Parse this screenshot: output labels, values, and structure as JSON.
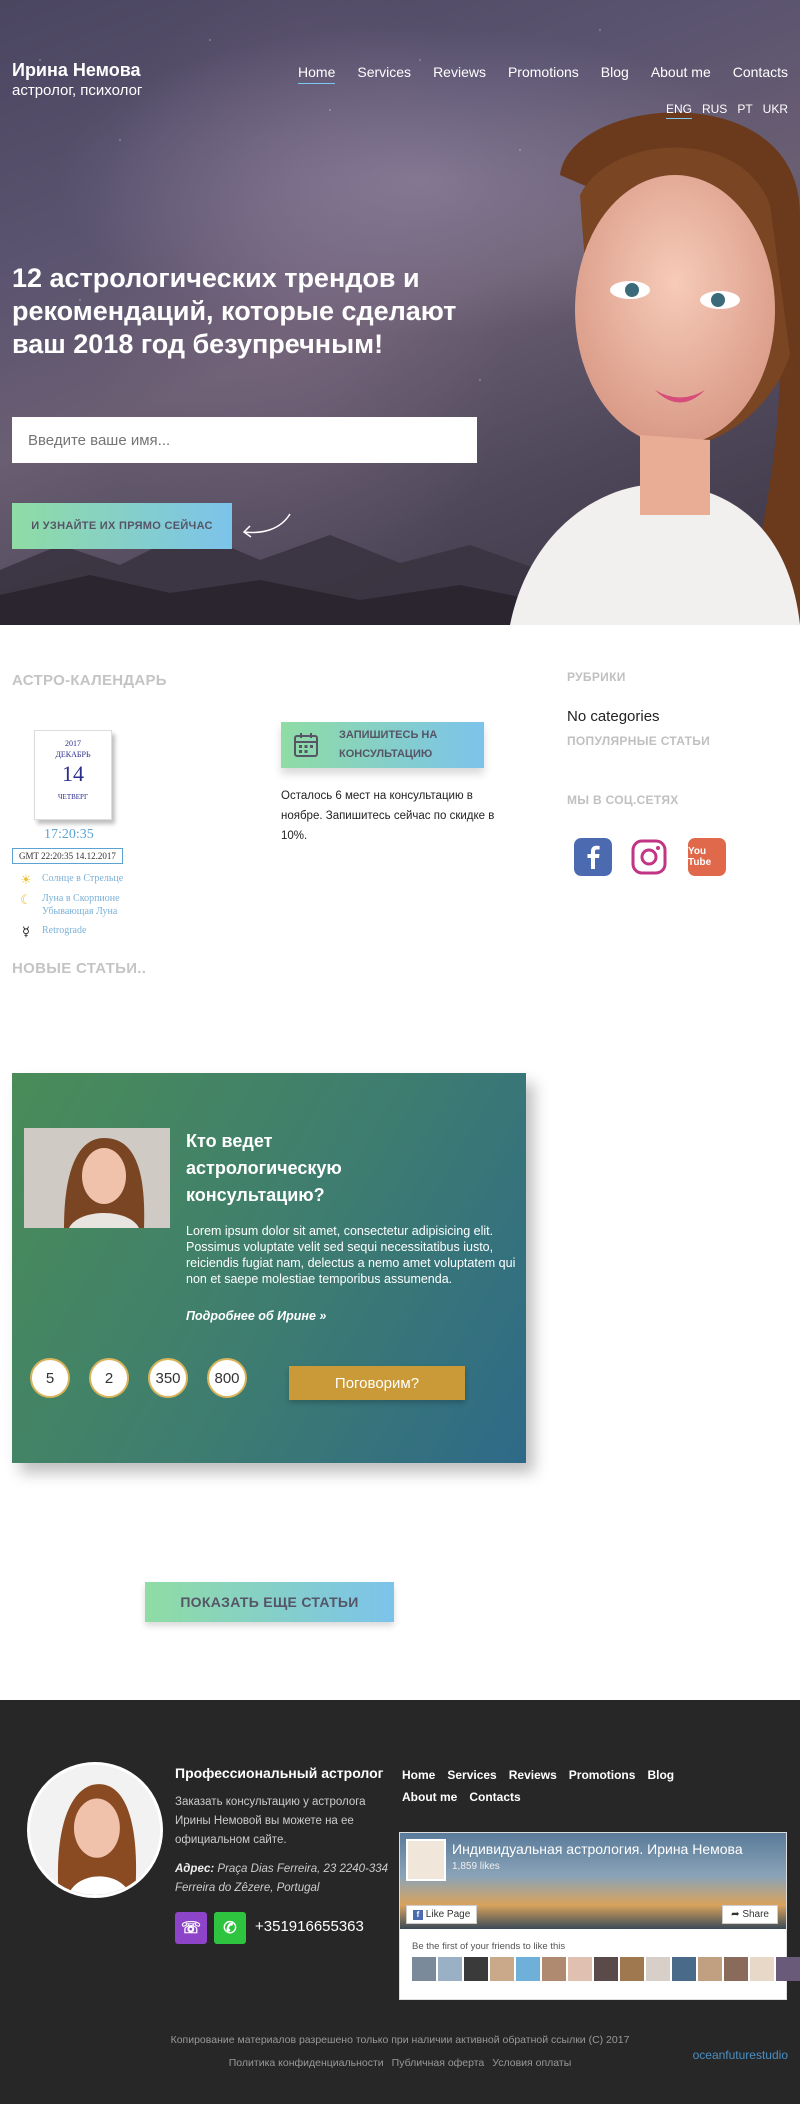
{
  "header": {
    "name": "Ирина Немова",
    "subtitle": "астролог, психолог",
    "nav": [
      "Home",
      "Services",
      "Reviews",
      "Promotions",
      "Blog",
      "About me",
      "Contacts"
    ],
    "nav_active": "Home",
    "languages": [
      "ENG",
      "RUS",
      "PT",
      "UKR"
    ],
    "language_active": "ENG"
  },
  "hero": {
    "title": "12 астрологических трендов и рекомендаций, которые сделают ваш 2018 год безупречным!",
    "name_placeholder": "Введите ваше имя...",
    "cta_label": "И УЗНАЙТЕ ИХ ПРЯМО СЕЙЧАС"
  },
  "astro": {
    "section_title": "АСТРО-КАЛЕНДАРЬ",
    "calendar_year": "2017",
    "calendar_month": "ДЕКАБРЬ",
    "calendar_day": "14",
    "calendar_weekday": "ЧЕТВЕРГ",
    "clock": "17:20:35",
    "gmt_label": "GMT",
    "gmt_time": "22:20:35",
    "gmt_date": "14.12.2017",
    "items": [
      {
        "icon": "sun-icon",
        "text": "Солнце в Стрельце"
      },
      {
        "icon": "moon-icon",
        "text": "Луна в Скорпионе"
      },
      {
        "icon": "moon-icon",
        "text": "Убывающая Луна"
      },
      {
        "icon": "retrograde-icon",
        "text": "Retrograde"
      }
    ]
  },
  "booking": {
    "label_line1": "ЗАПИШИТЕСЬ НА",
    "label_line2": "КОНСУЛЬТАЦИЮ",
    "text": "Осталось 6 мест на консультацию в ноябре. Запишитесь сейчас по скидке в 10%."
  },
  "sidebar": {
    "rubrics_title": "РУБРИКИ",
    "no_categories": "No categories",
    "popular_title": "ПОПУЛЯРНЫЕ СТАТЬИ",
    "social_title": "МЫ В СОЦ.СЕТЯХ",
    "social": [
      "facebook-icon",
      "instagram-icon",
      "youtube-icon"
    ],
    "youtube_text": "You Tube"
  },
  "articles": {
    "section_title": "НОВЫЕ СТАТЬИ..",
    "show_more": "ПОКАЗАТЬ ЕЩЕ СТАТЬИ"
  },
  "consult": {
    "title": "Кто ведет астрологическую консультацию?",
    "body": "Lorem ipsum dolor sit amet, consectetur adipisicing elit. Possimus voluptate velit sed sequi necessitatibus iusto, reiciendis fugiat nam, delectus a nemo amet voluptatem qui non et saepe molestiae temporibus assumenda.",
    "more_link": "Подробнее об Ирине  »",
    "stats": [
      "5",
      "2",
      "350",
      "800"
    ],
    "cta": "Поговорим?"
  },
  "footer": {
    "title": "Профессиональный астролог",
    "text": "Заказать консультацию у астролога Ирины Немовой вы можете на ее официальном сайте.",
    "address_label": "Адрес:",
    "address": "Praça Dias Ferreira, 23 2240-334 Ferreira do Zêzere, Portugal",
    "phone": "+351916655363",
    "nav": [
      "Home",
      "Services",
      "Reviews",
      "Promotions",
      "Blog",
      "About me",
      "Contacts"
    ],
    "fb_page_name": "Индивидуальная астрология. Ирина Немова",
    "fb_likes": "1,859 likes",
    "fb_like_btn": "Like Page",
    "fb_share_btn": "Share",
    "fb_friends": "Be the first of your friends to like this",
    "copyright": "Копирование материалов разрешено только при наличии активной обратной ссылки (С) 2017",
    "policy_links": [
      "Политика конфиденциальности",
      "Публичная оферта",
      "Условия оплаты"
    ],
    "studio": "oceanfuturestudio"
  },
  "colors": {
    "accent_gradient_start": "#8fdca4",
    "accent_gradient_end": "#7cc3eb",
    "gold": "#c99a37",
    "footer_bg": "#272727"
  }
}
